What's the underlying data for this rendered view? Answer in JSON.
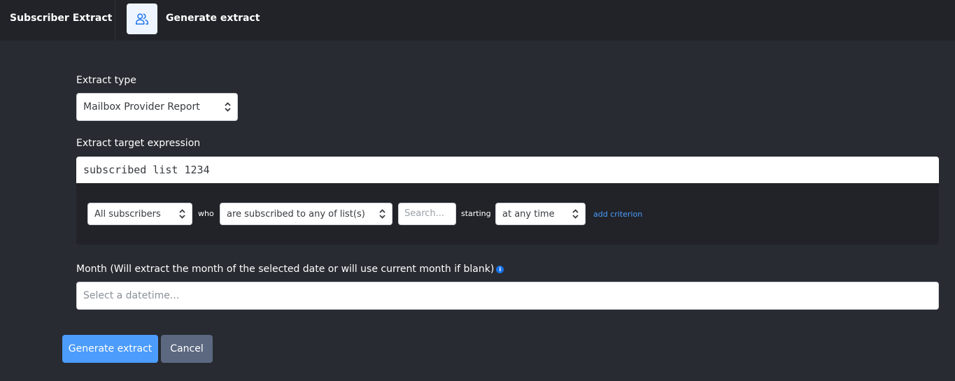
{
  "header": {
    "app_title": "Subscriber Extract",
    "page_icon": "users-icon",
    "page_title": "Generate extract"
  },
  "form": {
    "extract_type": {
      "label": "Extract type",
      "value": "Mailbox Provider Report"
    },
    "target_expression": {
      "label": "Extract target expression",
      "value": "subscribed list 1234",
      "criterion": {
        "subject": "All subscribers",
        "who_label": "who",
        "condition": "are subscribed to any of list(s)",
        "search_placeholder": "Search...",
        "starting_label": "starting",
        "timeframe": "at any time",
        "add_criterion": "add criterion"
      }
    },
    "month": {
      "label": "Month (Will extract the month of the selected date or will use current month if blank)",
      "info_icon": "i",
      "placeholder": "Select a datetime..."
    }
  },
  "actions": {
    "generate_label": "Generate extract",
    "cancel_label": "Cancel"
  },
  "colors": {
    "primary": "#4c9cfb",
    "secondary": "#5b6880",
    "link": "#4a9eff",
    "background": "#282b31",
    "topbar": "#212328"
  }
}
